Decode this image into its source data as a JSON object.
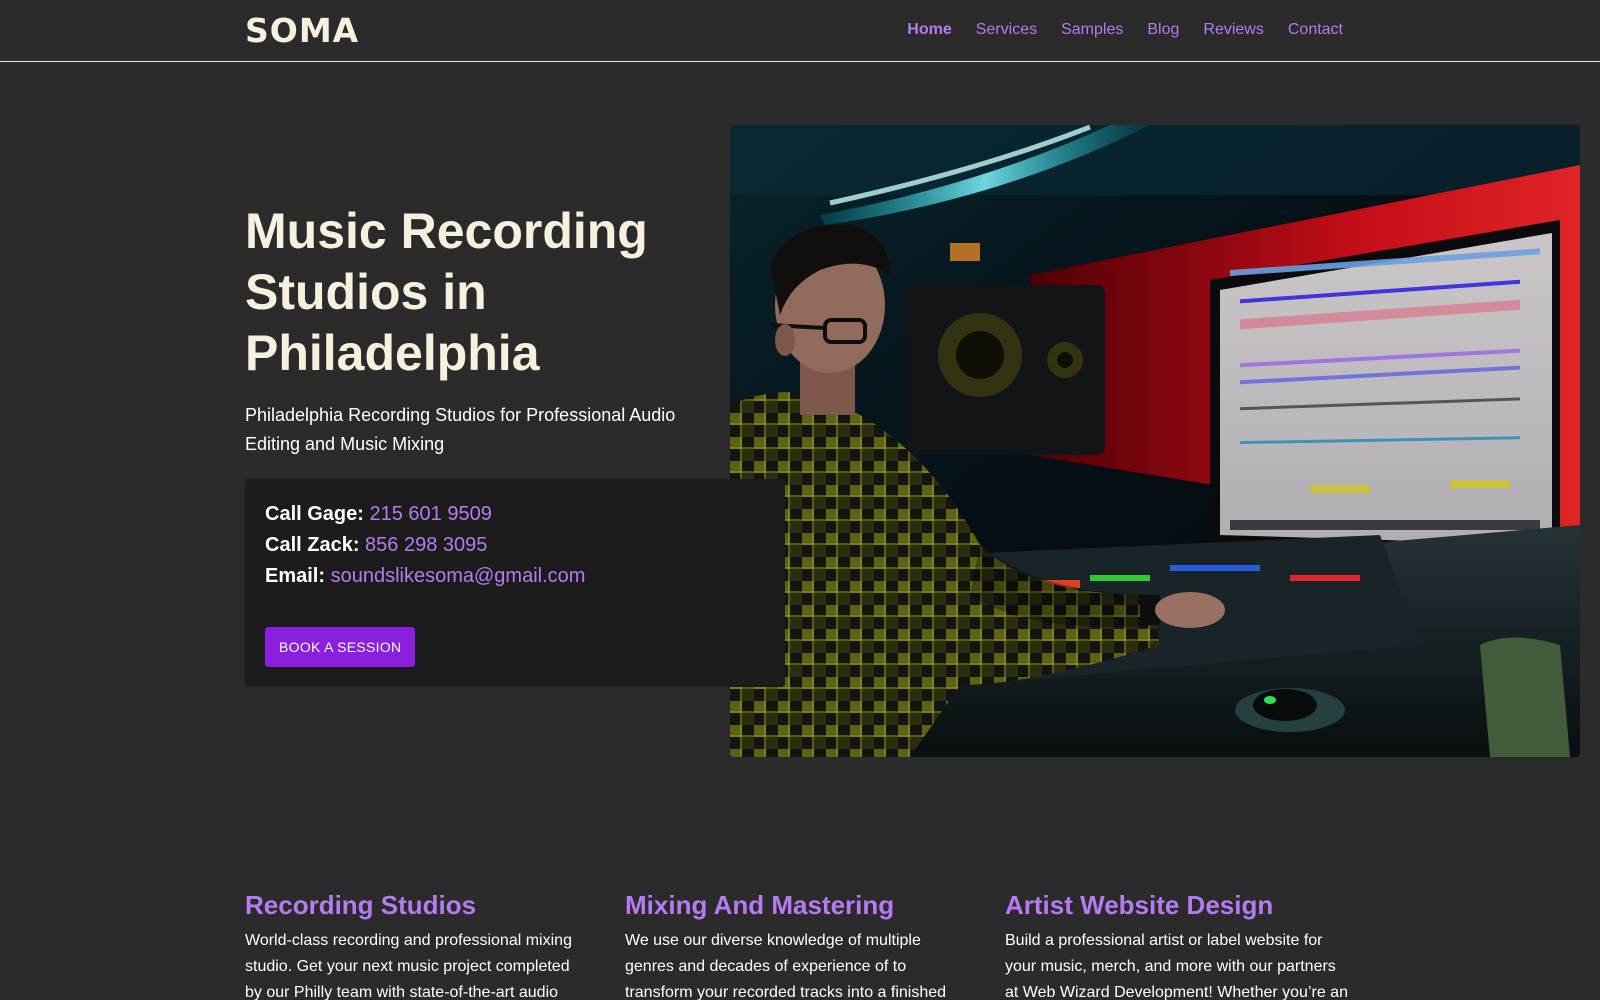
{
  "header": {
    "logo": "SOMA",
    "nav": [
      {
        "label": "Home",
        "active": true
      },
      {
        "label": "Services"
      },
      {
        "label": "Samples"
      },
      {
        "label": "Blog"
      },
      {
        "label": "Reviews"
      },
      {
        "label": "Contact"
      }
    ]
  },
  "hero": {
    "title": "Music Recording Studios in Philadelphia",
    "subtitle": "Philadelphia Recording Studios for Professional Audio Editing and Music Mixing",
    "image_icon": "studio-photo",
    "contact": {
      "gage_label": "Call Gage:",
      "gage_value": "215 601 9509",
      "zack_label": "Call Zack:",
      "zack_value": "856 298 3095",
      "email_label": "Email:",
      "email_value": "soundslikesoma@gmail.com"
    },
    "book_button": "BOOK A SESSION"
  },
  "services": [
    {
      "title": "Recording Studios",
      "text": "World-class recording and professional mixing studio. Get your next music project completed by our Philly team with state-of-the-art audio"
    },
    {
      "title": "Mixing And Mastering",
      "text": "We use our diverse knowledge of multiple genres and decades of experience of to transform your recorded tracks into a finished product ready for"
    },
    {
      "title": "Artist Website Design",
      "text": "Build a professional artist or label website for your music, merch, and more with our partners at Web Wizard Development! Whether you’re an"
    }
  ],
  "colors": {
    "background": "#2b2b2b",
    "accent": "#b57bf0",
    "button": "#8a1fe0",
    "card": "#1c1c1c",
    "heading": "#f6f1de"
  }
}
